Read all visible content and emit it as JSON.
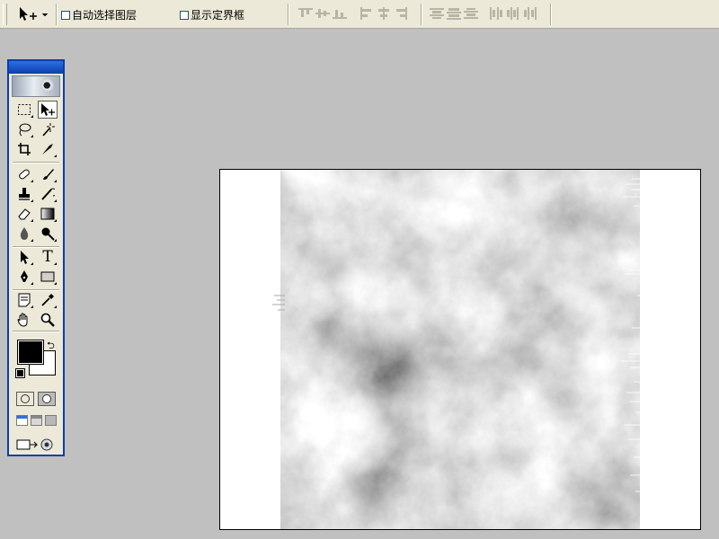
{
  "options_bar": {
    "tool_preset_icon": "move-tool-icon",
    "auto_select_layer": {
      "label": "自动选择图层",
      "checked": false
    },
    "show_bounding_box": {
      "label": "显示定界框",
      "checked": false
    },
    "align_buttons": [
      "align-top-edges",
      "align-vertical-centers",
      "align-bottom-edges",
      "align-left-edges",
      "align-horizontal-centers",
      "align-right-edges"
    ],
    "distribute_buttons": [
      "distribute-top",
      "distribute-vcenter",
      "distribute-bottom",
      "distribute-left",
      "distribute-hcenter",
      "distribute-right"
    ]
  },
  "toolbox": {
    "tools": [
      "rectangular-marquee-tool",
      "move-tool",
      "lasso-tool",
      "magic-wand-tool",
      "crop-tool",
      "slice-tool",
      "healing-brush-tool",
      "brush-tool",
      "clone-stamp-tool",
      "history-brush-tool",
      "eraser-tool",
      "gradient-tool",
      "blur-tool",
      "dodge-tool",
      "path-selection-tool",
      "type-tool",
      "pen-tool",
      "rectangle-shape-tool",
      "notes-tool",
      "eyedropper-tool",
      "hand-tool",
      "zoom-tool"
    ],
    "type_tool_glyph": "T",
    "foreground_color": "#000000",
    "background_color": "#ffffff",
    "active_tool": "move-tool"
  },
  "document": {
    "content": "grayscale clouds render on white canvas"
  }
}
